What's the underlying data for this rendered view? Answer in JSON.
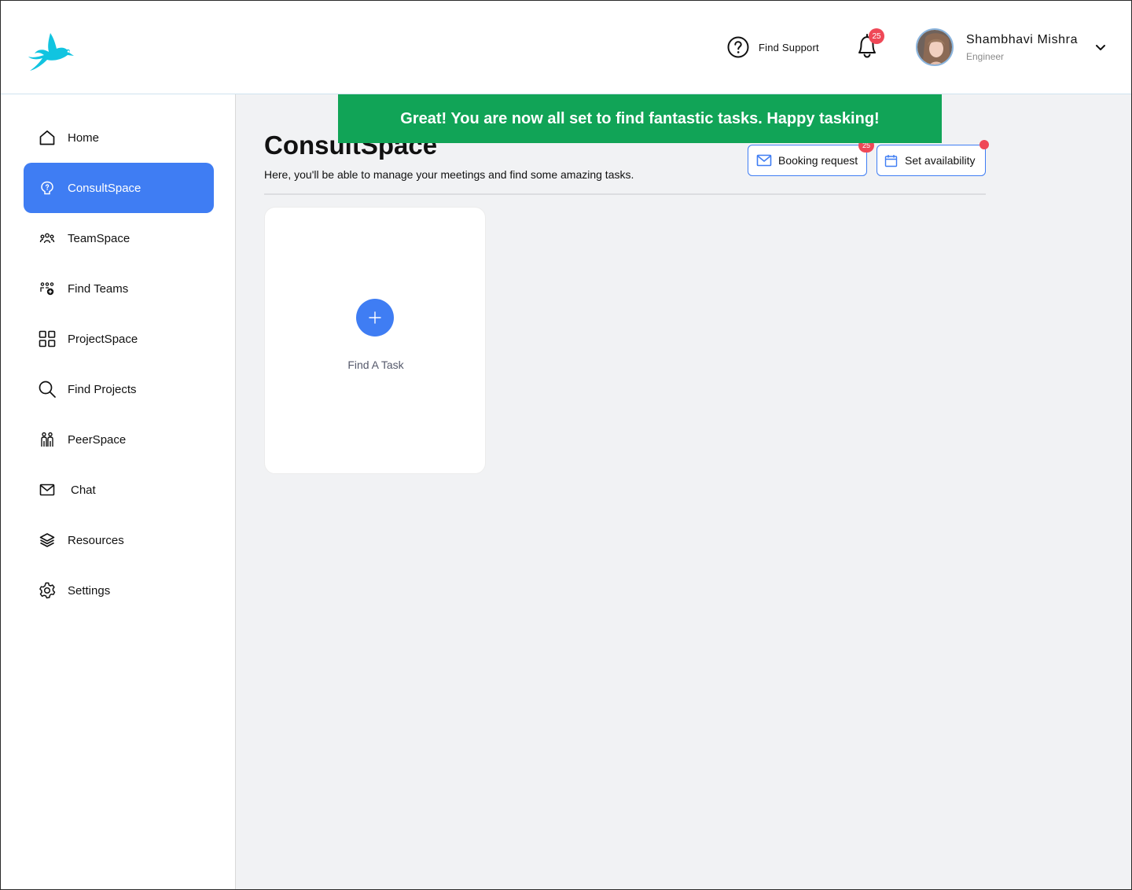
{
  "header": {
    "support_label": "Find Support",
    "notification_count": "25",
    "user": {
      "name": "Shambhavi Mishra",
      "role": "Engineer"
    }
  },
  "sidebar": {
    "items": [
      {
        "label": "Home",
        "icon": "home-icon"
      },
      {
        "label": "ConsultSpace",
        "icon": "consult-icon",
        "active": true
      },
      {
        "label": "TeamSpace",
        "icon": "team-icon"
      },
      {
        "label": "Find Teams",
        "icon": "find-teams-icon"
      },
      {
        "label": "ProjectSpace",
        "icon": "grid-icon"
      },
      {
        "label": "Find Projects",
        "icon": "search-icon"
      },
      {
        "label": "PeerSpace",
        "icon": "peer-icon"
      },
      {
        "label": "Chat",
        "icon": "mail-icon"
      },
      {
        "label": "Resources",
        "icon": "layers-icon"
      },
      {
        "label": "Settings",
        "icon": "gear-icon"
      }
    ]
  },
  "toast": {
    "message": "Great! You are now all set to find fantastic tasks. Happy tasking!"
  },
  "main": {
    "title": "ConsultSpace",
    "subtitle": "Here, you'll be able to manage your meetings and find some amazing tasks.",
    "booking_label": "Booking request",
    "booking_badge": "25",
    "availability_label": "Set availability",
    "task_card_label": "Find A Task"
  },
  "colors": {
    "accent": "#3f7df3",
    "toast": "#11a457",
    "badge": "#ef4857",
    "logo": "#11c4e0"
  }
}
